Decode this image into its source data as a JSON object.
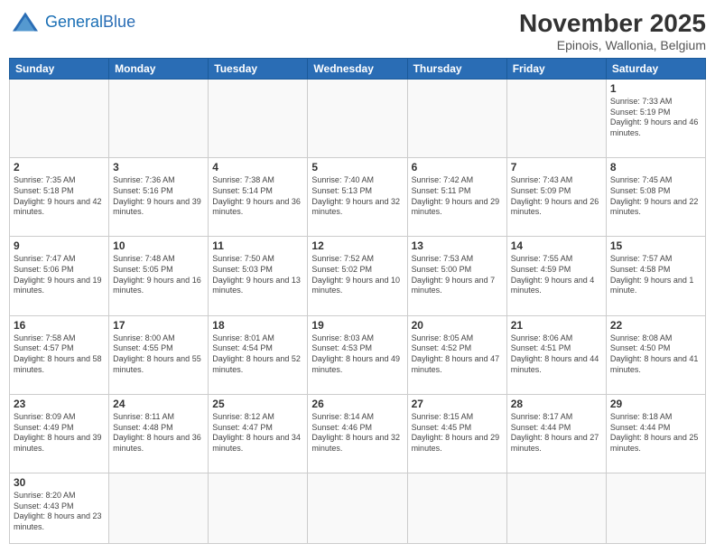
{
  "header": {
    "logo_general": "General",
    "logo_blue": "Blue",
    "month_title": "November 2025",
    "location": "Epinois, Wallonia, Belgium"
  },
  "days_of_week": [
    "Sunday",
    "Monday",
    "Tuesday",
    "Wednesday",
    "Thursday",
    "Friday",
    "Saturday"
  ],
  "weeks": [
    [
      {
        "day": "",
        "info": ""
      },
      {
        "day": "",
        "info": ""
      },
      {
        "day": "",
        "info": ""
      },
      {
        "day": "",
        "info": ""
      },
      {
        "day": "",
        "info": ""
      },
      {
        "day": "",
        "info": ""
      },
      {
        "day": "1",
        "info": "Sunrise: 7:33 AM\nSunset: 5:19 PM\nDaylight: 9 hours and 46 minutes."
      }
    ],
    [
      {
        "day": "2",
        "info": "Sunrise: 7:35 AM\nSunset: 5:18 PM\nDaylight: 9 hours and 42 minutes."
      },
      {
        "day": "3",
        "info": "Sunrise: 7:36 AM\nSunset: 5:16 PM\nDaylight: 9 hours and 39 minutes."
      },
      {
        "day": "4",
        "info": "Sunrise: 7:38 AM\nSunset: 5:14 PM\nDaylight: 9 hours and 36 minutes."
      },
      {
        "day": "5",
        "info": "Sunrise: 7:40 AM\nSunset: 5:13 PM\nDaylight: 9 hours and 32 minutes."
      },
      {
        "day": "6",
        "info": "Sunrise: 7:42 AM\nSunset: 5:11 PM\nDaylight: 9 hours and 29 minutes."
      },
      {
        "day": "7",
        "info": "Sunrise: 7:43 AM\nSunset: 5:09 PM\nDaylight: 9 hours and 26 minutes."
      },
      {
        "day": "8",
        "info": "Sunrise: 7:45 AM\nSunset: 5:08 PM\nDaylight: 9 hours and 22 minutes."
      }
    ],
    [
      {
        "day": "9",
        "info": "Sunrise: 7:47 AM\nSunset: 5:06 PM\nDaylight: 9 hours and 19 minutes."
      },
      {
        "day": "10",
        "info": "Sunrise: 7:48 AM\nSunset: 5:05 PM\nDaylight: 9 hours and 16 minutes."
      },
      {
        "day": "11",
        "info": "Sunrise: 7:50 AM\nSunset: 5:03 PM\nDaylight: 9 hours and 13 minutes."
      },
      {
        "day": "12",
        "info": "Sunrise: 7:52 AM\nSunset: 5:02 PM\nDaylight: 9 hours and 10 minutes."
      },
      {
        "day": "13",
        "info": "Sunrise: 7:53 AM\nSunset: 5:00 PM\nDaylight: 9 hours and 7 minutes."
      },
      {
        "day": "14",
        "info": "Sunrise: 7:55 AM\nSunset: 4:59 PM\nDaylight: 9 hours and 4 minutes."
      },
      {
        "day": "15",
        "info": "Sunrise: 7:57 AM\nSunset: 4:58 PM\nDaylight: 9 hours and 1 minute."
      }
    ],
    [
      {
        "day": "16",
        "info": "Sunrise: 7:58 AM\nSunset: 4:57 PM\nDaylight: 8 hours and 58 minutes."
      },
      {
        "day": "17",
        "info": "Sunrise: 8:00 AM\nSunset: 4:55 PM\nDaylight: 8 hours and 55 minutes."
      },
      {
        "day": "18",
        "info": "Sunrise: 8:01 AM\nSunset: 4:54 PM\nDaylight: 8 hours and 52 minutes."
      },
      {
        "day": "19",
        "info": "Sunrise: 8:03 AM\nSunset: 4:53 PM\nDaylight: 8 hours and 49 minutes."
      },
      {
        "day": "20",
        "info": "Sunrise: 8:05 AM\nSunset: 4:52 PM\nDaylight: 8 hours and 47 minutes."
      },
      {
        "day": "21",
        "info": "Sunrise: 8:06 AM\nSunset: 4:51 PM\nDaylight: 8 hours and 44 minutes."
      },
      {
        "day": "22",
        "info": "Sunrise: 8:08 AM\nSunset: 4:50 PM\nDaylight: 8 hours and 41 minutes."
      }
    ],
    [
      {
        "day": "23",
        "info": "Sunrise: 8:09 AM\nSunset: 4:49 PM\nDaylight: 8 hours and 39 minutes."
      },
      {
        "day": "24",
        "info": "Sunrise: 8:11 AM\nSunset: 4:48 PM\nDaylight: 8 hours and 36 minutes."
      },
      {
        "day": "25",
        "info": "Sunrise: 8:12 AM\nSunset: 4:47 PM\nDaylight: 8 hours and 34 minutes."
      },
      {
        "day": "26",
        "info": "Sunrise: 8:14 AM\nSunset: 4:46 PM\nDaylight: 8 hours and 32 minutes."
      },
      {
        "day": "27",
        "info": "Sunrise: 8:15 AM\nSunset: 4:45 PM\nDaylight: 8 hours and 29 minutes."
      },
      {
        "day": "28",
        "info": "Sunrise: 8:17 AM\nSunset: 4:44 PM\nDaylight: 8 hours and 27 minutes."
      },
      {
        "day": "29",
        "info": "Sunrise: 8:18 AM\nSunset: 4:44 PM\nDaylight: 8 hours and 25 minutes."
      }
    ],
    [
      {
        "day": "30",
        "info": "Sunrise: 8:20 AM\nSunset: 4:43 PM\nDaylight: 8 hours and 23 minutes."
      },
      {
        "day": "",
        "info": ""
      },
      {
        "day": "",
        "info": ""
      },
      {
        "day": "",
        "info": ""
      },
      {
        "day": "",
        "info": ""
      },
      {
        "day": "",
        "info": ""
      },
      {
        "day": "",
        "info": ""
      }
    ]
  ]
}
